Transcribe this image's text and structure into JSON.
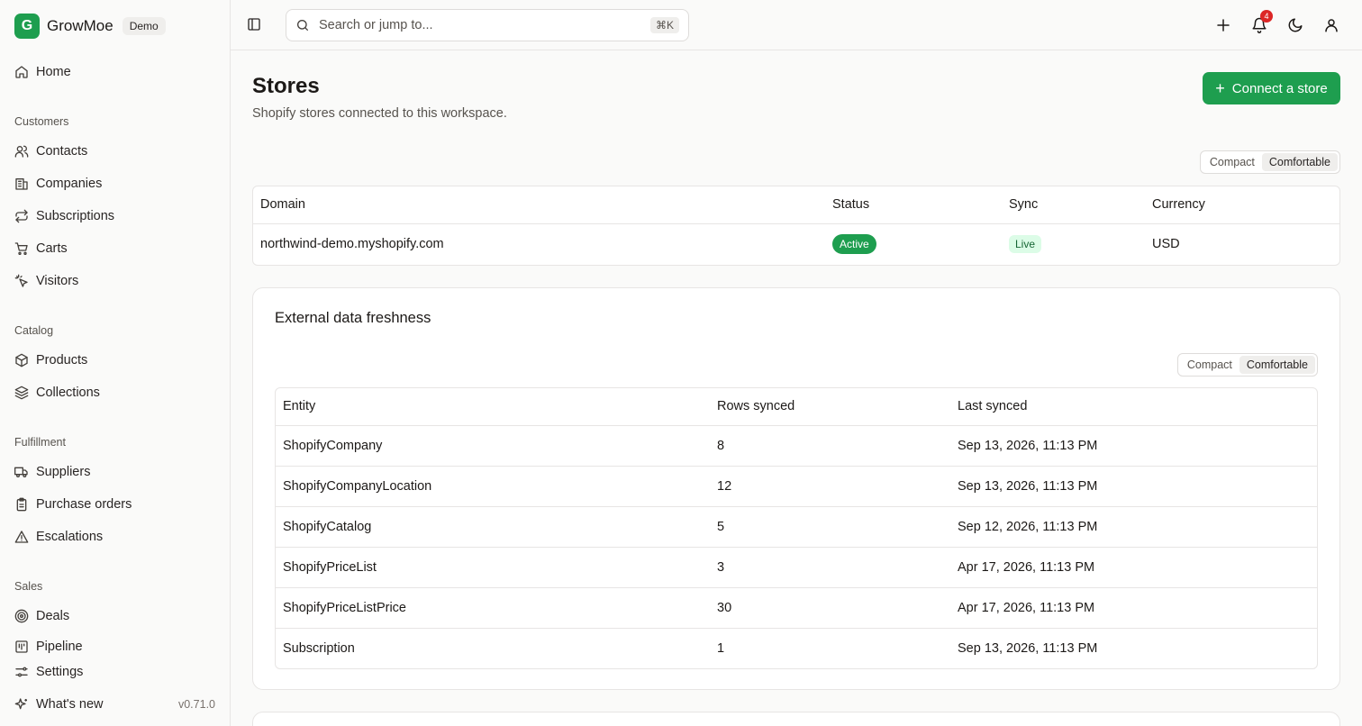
{
  "brand": {
    "logo_letter": "G",
    "name": "GrowMoe",
    "badge": "Demo",
    "accent": "#1e9e4f"
  },
  "sidebar": {
    "home": "Home",
    "sections": [
      {
        "title": "Customers",
        "items": [
          "Contacts",
          "Companies",
          "Subscriptions",
          "Carts",
          "Visitors"
        ]
      },
      {
        "title": "Catalog",
        "items": [
          "Products",
          "Collections"
        ]
      },
      {
        "title": "Fulfillment",
        "items": [
          "Suppliers",
          "Purchase orders",
          "Escalations"
        ]
      },
      {
        "title": "Sales",
        "items": [
          "Deals",
          "Pipeline"
        ]
      }
    ],
    "footer": {
      "settings": "Settings",
      "whats_new": "What's new",
      "version": "v0.71.0"
    }
  },
  "topbar": {
    "search_placeholder": "Search or jump to...",
    "search_shortcut": "⌘K",
    "notification_count": "4"
  },
  "page": {
    "title": "Stores",
    "subtitle": "Shopify stores connected to this workspace.",
    "connect_button": "Connect a store",
    "density": {
      "compact": "Compact",
      "comfortable": "Comfortable",
      "selected": "Comfortable"
    }
  },
  "stores_table": {
    "headers": [
      "Domain",
      "Status",
      "Sync",
      "Currency"
    ],
    "rows": [
      {
        "domain": "northwind-demo.myshopify.com",
        "status": "Active",
        "sync": "Live",
        "currency": "USD"
      }
    ]
  },
  "freshness": {
    "title": "External data freshness",
    "density": {
      "compact": "Compact",
      "comfortable": "Comfortable",
      "selected": "Comfortable"
    },
    "headers": [
      "Entity",
      "Rows synced",
      "Last synced"
    ],
    "rows": [
      {
        "entity": "ShopifyCompany",
        "rows": "8",
        "last": "Sep 13, 2026, 11:13 PM"
      },
      {
        "entity": "ShopifyCompanyLocation",
        "rows": "12",
        "last": "Sep 13, 2026, 11:13 PM"
      },
      {
        "entity": "ShopifyCatalog",
        "rows": "5",
        "last": "Sep 12, 2026, 11:13 PM"
      },
      {
        "entity": "ShopifyPriceList",
        "rows": "3",
        "last": "Apr 17, 2026, 11:13 PM"
      },
      {
        "entity": "ShopifyPriceListPrice",
        "rows": "30",
        "last": "Apr 17, 2026, 11:13 PM"
      },
      {
        "entity": "Subscription",
        "rows": "1",
        "last": "Sep 13, 2026, 11:13 PM"
      }
    ]
  }
}
